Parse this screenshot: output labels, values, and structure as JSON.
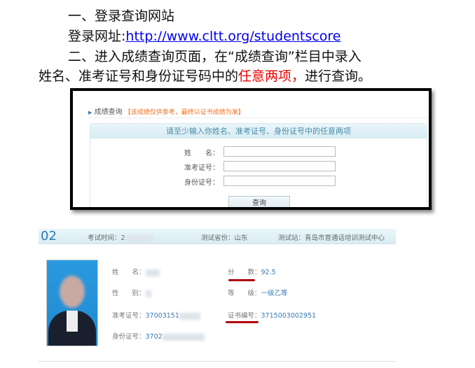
{
  "doc": {
    "step1": "一、登录查询网站",
    "url_label": "登录网址:",
    "url": "http://www.cltt.org/studentscore",
    "step2_a": "二、进入成绩查询页面，在“成绩查询”栏目中录入",
    "step2_b": "姓名、准考证号和身份证号码中的",
    "step2_red": "任意两项，",
    "step2_c": "进行查询。"
  },
  "query": {
    "title": "成绩查询",
    "notice": "【该成绩仅供参考，最终以证书成绩为准】",
    "band": "请至少输入你姓名、准考证号、身份证号中的任意两项",
    "fields": [
      "姓　　名：",
      "准考证号：",
      "身份证号："
    ],
    "button": "查询"
  },
  "result": {
    "index": "02",
    "exam_time": "考试时间：2",
    "province": "测试省份：山东",
    "station": "测试站：青岛市普通话培训测试中心",
    "name": "姓　　名：",
    "gender": "性　　别：",
    "ticket": "准考证号：",
    "ticket_value": "37003151",
    "id": "身份证号：",
    "id_value": "3702",
    "score_label": "分　　数：",
    "score": "92.5",
    "level_label": "等　　级：",
    "level": "一级乙等",
    "cert_label": "证书编号：",
    "cert": "3715003002951"
  }
}
